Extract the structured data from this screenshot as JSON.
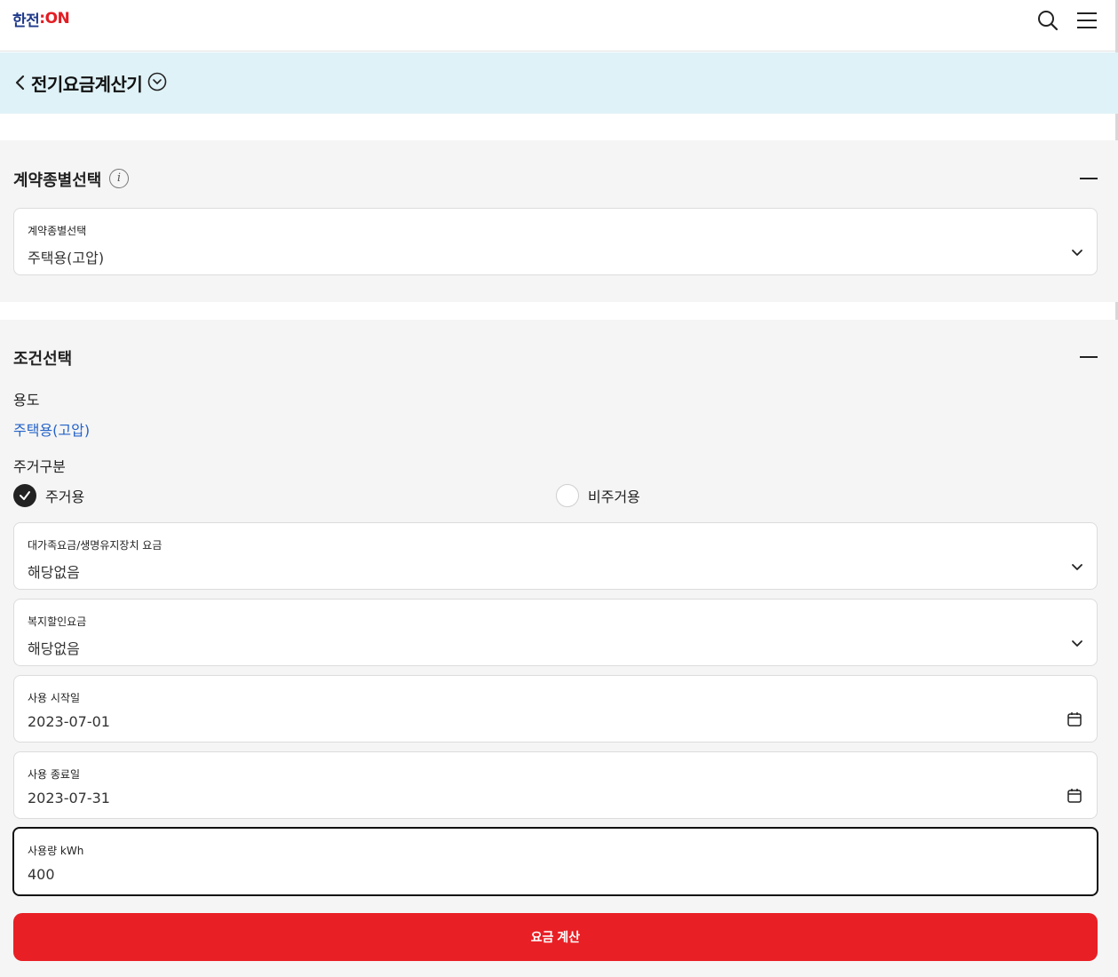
{
  "header": {
    "logo_part1": "한전",
    "logo_part2": ":ON",
    "search_icon": "search-icon",
    "menu_icon": "hamburger-menu-icon"
  },
  "subheader": {
    "title": "전기요금계산기",
    "back_icon": "chevron-left-icon",
    "dropdown_icon": "circle-chevron-down-icon"
  },
  "contract_section": {
    "title": "계약종별선택",
    "field_label": "계약종별선택",
    "field_value": "주택용(고압)"
  },
  "condition_section": {
    "title": "조건선택",
    "usage_label": "용도",
    "usage_value": "주택용(고압)",
    "residence_label": "주거구분",
    "residence_options": [
      {
        "label": "주거용",
        "checked": true
      },
      {
        "label": "비주거용",
        "checked": false
      }
    ],
    "family_field": {
      "label": "대가족요금/생명유지장치 요금",
      "value": "해당없음"
    },
    "welfare_field": {
      "label": "복지할인요금",
      "value": "해당없음"
    },
    "start_date": {
      "label": "사용 시작일",
      "value": "2023-07-01"
    },
    "end_date": {
      "label": "사용 종료일",
      "value": "2023-07-31"
    },
    "usage_amount": {
      "label": "사용량 kWh",
      "value": "400"
    }
  },
  "calculate_button": "요금 계산",
  "colors": {
    "accent_red": "#e81f25",
    "link_blue": "#2563c9",
    "subheader_bg": "#dff2f7",
    "section_bg": "#f5f5f5"
  }
}
